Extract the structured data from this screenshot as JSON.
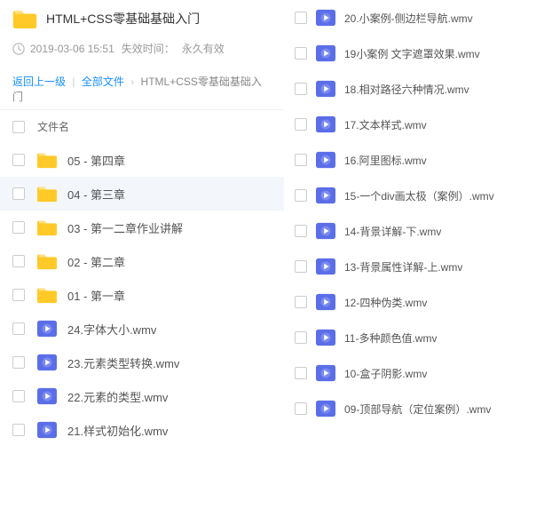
{
  "header": {
    "title": "HTML+CSS零基础基础入门",
    "date": "2019-03-06 15:51",
    "expire_label": "失效时间：",
    "expire_value": "永久有效"
  },
  "breadcrumb": {
    "back": "返回上一级",
    "all": "全部文件",
    "current": "HTML+CSS零基础基础入门"
  },
  "list_header": {
    "name_col": "文件名"
  },
  "left_items": [
    {
      "type": "folder",
      "name": "05 - 第四章"
    },
    {
      "type": "folder",
      "name": "04 - 第三章",
      "highlight": true
    },
    {
      "type": "folder",
      "name": "03 - 第一二章作业讲解"
    },
    {
      "type": "folder",
      "name": "02 - 第二章"
    },
    {
      "type": "folder",
      "name": "01 - 第一章"
    },
    {
      "type": "video",
      "name": "24.字体大小.wmv"
    },
    {
      "type": "video",
      "name": "23.元素类型转换.wmv"
    },
    {
      "type": "video",
      "name": "22.元素的类型.wmv"
    },
    {
      "type": "video",
      "name": "21.样式初始化.wmv"
    }
  ],
  "right_items": [
    {
      "name": "20.小案例-侧边栏导航.wmv"
    },
    {
      "name": "19小案例 文字遮罩效果.wmv"
    },
    {
      "name": "18.相对路径六种情况.wmv"
    },
    {
      "name": "17.文本样式.wmv",
      "highlight": true
    },
    {
      "name": "16.阿里图标.wmv"
    },
    {
      "name": "15-一个div画太极（案例）.wmv"
    },
    {
      "name": "14-背景详解-下.wmv"
    },
    {
      "name": "13-背景属性详解-上.wmv"
    },
    {
      "name": "12-四种伪类.wmv"
    },
    {
      "name": "11-多种颜色值.wmv"
    },
    {
      "name": "10-盒子阴影.wmv"
    },
    {
      "name": "09-顶部导航（定位案例）.wmv"
    }
  ]
}
